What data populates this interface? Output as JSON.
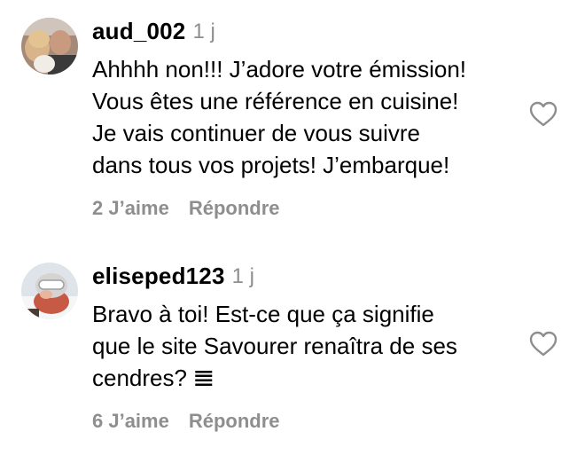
{
  "comments": [
    {
      "username": "aud_002",
      "timestamp": "1 j",
      "text": "Ahhhh non!!! J’adore votre émission!\nVous êtes une référence en cuisine!\nJe vais continuer de vous suivre\ndans tous vos projets! J’embarque!",
      "likes": "2 J’aime",
      "reply": "Répondre",
      "like_icon": "heart-outline-icon"
    },
    {
      "username": "eliseped123",
      "timestamp": "1 j",
      "text": "Bravo à toi! Est-ce que ça signifie\nque le site Savourer renaîtra de ses\ncendres? 𝌆",
      "likes": "6 J’aime",
      "reply": "Répondre",
      "like_icon": "heart-outline-icon"
    }
  ],
  "colors": {
    "text": "#000000",
    "secondary": "#8e8e8e",
    "background": "#ffffff"
  }
}
